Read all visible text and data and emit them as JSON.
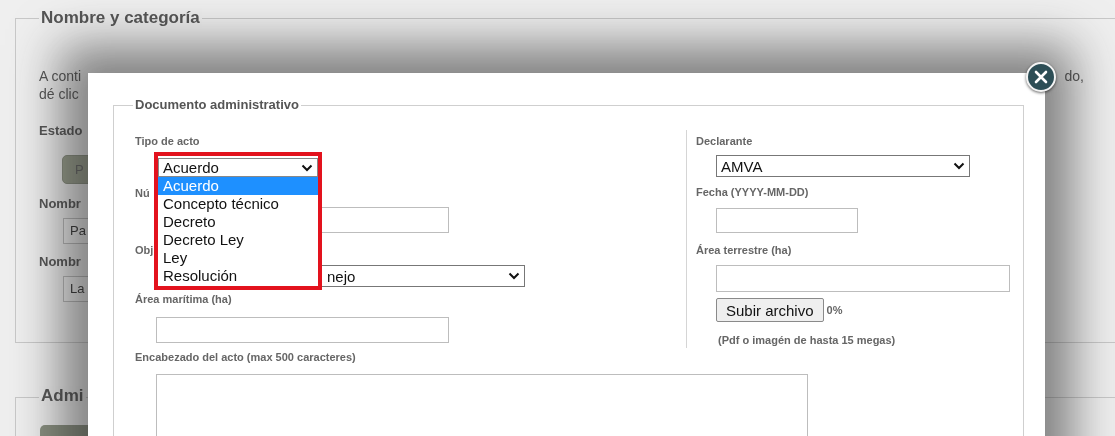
{
  "background": {
    "section_title": "Nombre y categoría",
    "intro_start": "A conti",
    "intro_end": "do,",
    "intro_line2": "dé clic",
    "state_label": "Estado",
    "state_button": "P",
    "name_fields": [
      {
        "label": "Nombr",
        "value": "Pa"
      },
      {
        "label": "Nombr",
        "value": "La"
      }
    ],
    "second_section_title": "Admi"
  },
  "dialog": {
    "title": "Documento administrativo",
    "left_fields": [
      {
        "kind": "dropdown",
        "label": "Tipo de acto",
        "value": "Acuerdo",
        "options": [
          {
            "label": "Acuerdo",
            "selected": true
          },
          {
            "label": "Concepto técnico",
            "selected": false
          },
          {
            "label": "Decreto",
            "selected": false
          },
          {
            "label": "Decreto Ley",
            "selected": false
          },
          {
            "label": "Ley",
            "selected": false
          },
          {
            "label": "Resolución",
            "selected": false
          }
        ]
      },
      {
        "kind": "input",
        "label": "Nú"
      },
      {
        "kind": "select",
        "label": "Obj",
        "value": "nejo"
      },
      {
        "kind": "input",
        "label": "Área marítima (ha)"
      },
      {
        "kind": "textarea",
        "label": "Encabezado del acto (max 500 caracteres)"
      }
    ],
    "right_fields": [
      {
        "kind": "select",
        "label": "Declarante",
        "value": "AMVA"
      },
      {
        "kind": "input",
        "label": "Fecha (YYYY-MM-DD)"
      },
      {
        "kind": "input",
        "label": "Área terrestre (ha)"
      },
      {
        "kind": "upload",
        "button": "Subir archivo",
        "progress": "0%",
        "hint": "(Pdf o imagén de hasta 15 megas)"
      }
    ]
  }
}
